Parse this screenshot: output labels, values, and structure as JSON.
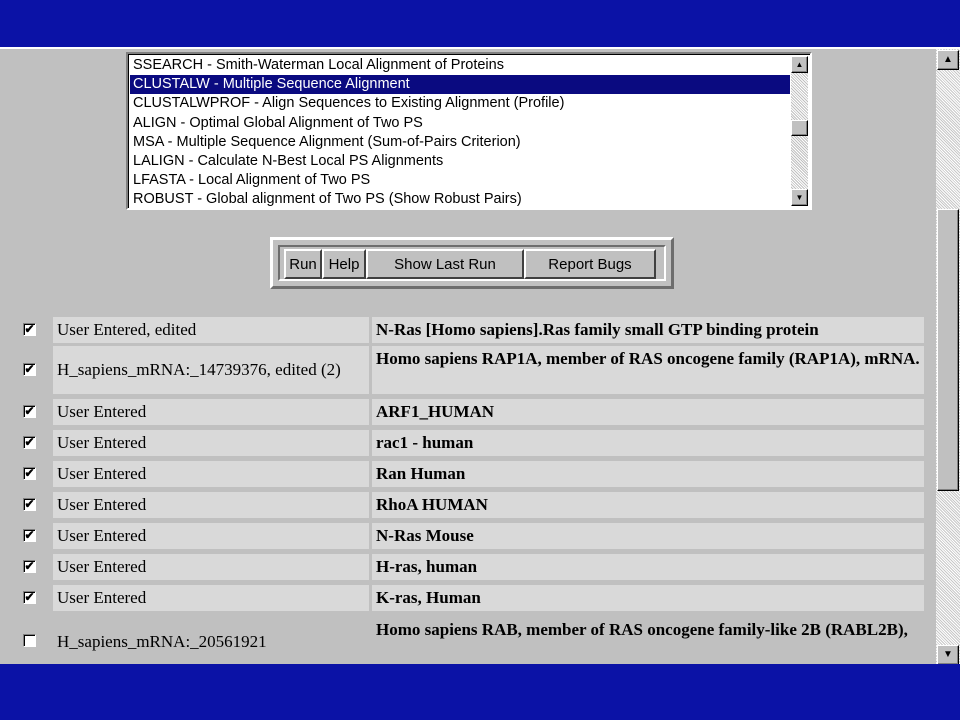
{
  "program_list": [
    "SSEARCH - Smith-Waterman Local Alignment of Proteins",
    "CLUSTALW - Multiple Sequence Alignment",
    "CLUSTALWPROF - Align Sequences to Existing Alignment (Profile)",
    "ALIGN - Optimal Global Alignment of Two PS",
    "MSA - Multiple Sequence Alignment (Sum-of-Pairs Criterion)",
    "LALIGN - Calculate N-Best Local PS Alignments",
    "LFASTA - Local Alignment of Two PS",
    "ROBUST - Global alignment of Two PS (Show Robust Pairs)"
  ],
  "selected_program": "CLUSTALW - Multiple Sequence Alignment",
  "buttons": {
    "run": "Run",
    "help": "Help",
    "show_last_run": "Show Last Run",
    "report_bugs": "Report Bugs"
  },
  "sequences": [
    {
      "checked": true,
      "source": "User Entered, edited",
      "description": "N-Ras [Homo sapiens].Ras family small GTP binding protein"
    },
    {
      "checked": true,
      "source": "H_sapiens_mRNA:_14739376, edited (2)",
      "description": "Homo sapiens RAP1A, member of RAS oncogene family (RAP1A), mRNA."
    },
    {
      "checked": true,
      "source": "User Entered",
      "description": "ARF1_HUMAN"
    },
    {
      "checked": true,
      "source": "User Entered",
      "description": "rac1 - human"
    },
    {
      "checked": true,
      "source": "User Entered",
      "description": "Ran Human"
    },
    {
      "checked": true,
      "source": "User Entered",
      "description": "RhoA HUMAN"
    },
    {
      "checked": true,
      "source": "User Entered",
      "description": "N-Ras Mouse"
    },
    {
      "checked": true,
      "source": "User Entered",
      "description": "H-ras, human"
    },
    {
      "checked": true,
      "source": "User Entered",
      "description": "K-ras, Human"
    },
    {
      "checked": false,
      "source": "H_sapiens_mRNA:_20561921",
      "description": "Homo sapiens RAB, member of RAS oncogene family-like 2B (RABL2B),"
    }
  ],
  "check_glyph": "✔",
  "colors": {
    "background": "#0b12a6",
    "selection": "#0a0a80",
    "panel": "#c0c0c0"
  }
}
